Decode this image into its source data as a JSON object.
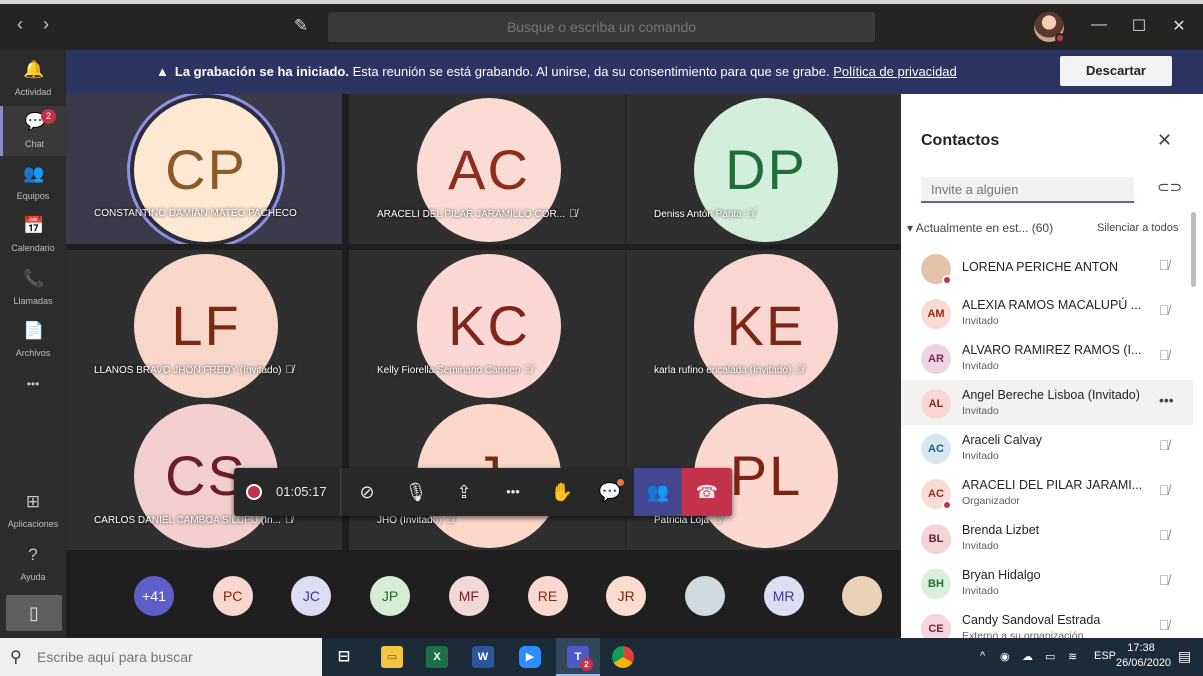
{
  "titlebar": {
    "search_placeholder": "Busque o escriba un comando",
    "back": "‹",
    "forward": "›",
    "compose": "✎",
    "minimize": "—",
    "maximize": "☐",
    "close": "✕"
  },
  "rail": {
    "items": [
      {
        "label": "Actividad",
        "icon": "bell-icon",
        "glyph": "🔔"
      },
      {
        "label": "Chat",
        "icon": "chat-icon",
        "glyph": "💬",
        "badge": "2"
      },
      {
        "label": "Equipos",
        "icon": "teams-icon",
        "glyph": "👥"
      },
      {
        "label": "Calendario",
        "icon": "calendar-icon",
        "glyph": "📅"
      },
      {
        "label": "Llamadas",
        "icon": "phone-icon",
        "glyph": "📞"
      },
      {
        "label": "Archivos",
        "icon": "file-icon",
        "glyph": "📄"
      },
      {
        "label": "",
        "icon": "more-icon",
        "glyph": "•••"
      },
      {
        "label": "Aplicaciones",
        "icon": "apps-icon",
        "glyph": "⊞"
      },
      {
        "label": "Ayuda",
        "icon": "help-icon",
        "glyph": "?"
      }
    ],
    "device_glyph": "▯"
  },
  "banner": {
    "bold": "La grabación se ha iniciado.",
    "text": " Esta reunión se está grabando. Al unirse, da su consentimiento para que se grabe. ",
    "link": "Política de privacidad",
    "dismiss": "Descartar",
    "warn_glyph": "▲"
  },
  "tiles": [
    {
      "initials": "CP",
      "name": "CONSTANTINO DAMIAN MATEO PACHECO",
      "muted": false,
      "bg": "#fde9d3",
      "fg": "#8c5a26",
      "active": true
    },
    {
      "initials": "AC",
      "name": "ARACELI DEL PILAR JARAMILLO COR...",
      "muted": true,
      "bg": "#fbdcd5",
      "fg": "#8e2d1f",
      "active": false
    },
    {
      "initials": "DP",
      "name": "Deniss Antón Panta",
      "muted": true,
      "bg": "#d4eedd",
      "fg": "#1f6e38",
      "active": false
    },
    {
      "initials": "LF",
      "name": "LLANOS BRAVO JHON FREDY (Invitado)",
      "muted": true,
      "bg": "#f8d7cb",
      "fg": "#7d2a12",
      "active": false
    },
    {
      "initials": "KC",
      "name": "Kelly Fiorella Seminario Carmen",
      "muted": true,
      "bg": "#fbd8d3",
      "fg": "#80251c",
      "active": false
    },
    {
      "initials": "KE",
      "name": "karla rufino encalada (Invitado)",
      "muted": true,
      "bg": "#f9d6cf",
      "fg": "#7c2617",
      "active": false
    },
    {
      "initials": "CS",
      "name": "CARLOS DANIEL CAMBOA SILUPU (In...",
      "muted": true,
      "bg": "#f4cfd0",
      "fg": "#6b1e24",
      "active": false
    },
    {
      "initials": "J",
      "name": "JHO (Invitado)",
      "muted": true,
      "bg": "#fcd8cb",
      "fg": "#7a2a10",
      "active": false
    },
    {
      "initials": "PL",
      "name": "Patricia Loja",
      "muted": true,
      "bg": "#fbd8d0",
      "fg": "#7e2415",
      "active": false
    }
  ],
  "mic_off_glyph": "🎙̸",
  "toolbar": {
    "time": "01:05:17",
    "video_glyph": "⊘",
    "mic_glyph": "🎙",
    "share_glyph": "⇪",
    "more_glyph": "•••",
    "hand_glyph": "✋",
    "chat_glyph": "💬",
    "people_glyph": "👥",
    "hangup_glyph": "☎"
  },
  "strip": [
    {
      "text": "+41",
      "bg": "#5b5fc7",
      "fg": "#ffffff"
    },
    {
      "text": "PC",
      "bg": "#f8d7cf",
      "fg": "#7c2616"
    },
    {
      "text": "JC",
      "bg": "#dcdcf2",
      "fg": "#3b3f8f"
    },
    {
      "text": "JP",
      "bg": "#d6ecd4",
      "fg": "#2b6a27"
    },
    {
      "text": "MF",
      "bg": "#f2d7d7",
      "fg": "#6b2323"
    },
    {
      "text": "RE",
      "bg": "#fbd8cf",
      "fg": "#8a2a18"
    },
    {
      "text": "JR",
      "bg": "#fbdcd0",
      "fg": "#7a2915"
    },
    {
      "text": "",
      "bg": "#cfd9de",
      "fg": "#333333"
    },
    {
      "text": "MR",
      "bg": "#dcdcf2",
      "fg": "#3a3e8c"
    },
    {
      "text": "",
      "bg": "#e9d2b8",
      "fg": "#333333"
    }
  ],
  "panel": {
    "title": "Contactos",
    "close": "✕",
    "invite_placeholder": "Invite a alguien",
    "link_glyph": "⊂⊃",
    "section": "Actualmente en est...  (60)",
    "mute_all": "Silenciar a todos",
    "people": [
      {
        "initials": "",
        "name": "LORENA PERICHE ANTON",
        "role": "",
        "bg": "#e3c3a8",
        "fg": "#5a3a2c",
        "dot": true
      },
      {
        "initials": "AM",
        "name": "ALEXIA RAMOS MACALUPÚ ...",
        "role": "Invitado",
        "bg": "#f8dcd3",
        "fg": "#8b2e1b",
        "dot": false
      },
      {
        "initials": "AR",
        "name": "ALVARO RAMIREZ RAMOS (I...",
        "role": "Invitado",
        "bg": "#efd5e2",
        "fg": "#7b2a55",
        "dot": false
      },
      {
        "initials": "AL",
        "name": "Angel Bereche Lisboa (Invitado)",
        "role": "Invitado",
        "bg": "#f7d8d4",
        "fg": "#7e2a21",
        "dot": false,
        "more": "•••"
      },
      {
        "initials": "AC",
        "name": "Araceli Calvay",
        "role": "Invitado",
        "bg": "#d7e8f1",
        "fg": "#1f5c80",
        "dot": false
      },
      {
        "initials": "AC",
        "name": "ARACELI DEL PILAR JARAMI...",
        "role": "Organizador",
        "bg": "#fbdcd5",
        "fg": "#8e2d1f",
        "dot": true
      },
      {
        "initials": "BL",
        "name": "Brenda Lizbet",
        "role": "Invitado",
        "bg": "#f3d5d8",
        "fg": "#6e2029",
        "dot": false
      },
      {
        "initials": "BH",
        "name": "Bryan Hidalgo",
        "role": "Invitado",
        "bg": "#d9eedd",
        "fg": "#256b35",
        "dot": false
      },
      {
        "initials": "CE",
        "name": "Candy Sandoval Estrada",
        "role": "Externo a su organización",
        "bg": "#f6d5dc",
        "fg": "#7a2335",
        "dot": false
      }
    ]
  },
  "taskbar": {
    "search": "Escribe aquí para buscar",
    "search_glyph": "⚲",
    "lang": "ESP",
    "time": "17:38",
    "date": "26/06/2020",
    "teams_badge": "2"
  }
}
